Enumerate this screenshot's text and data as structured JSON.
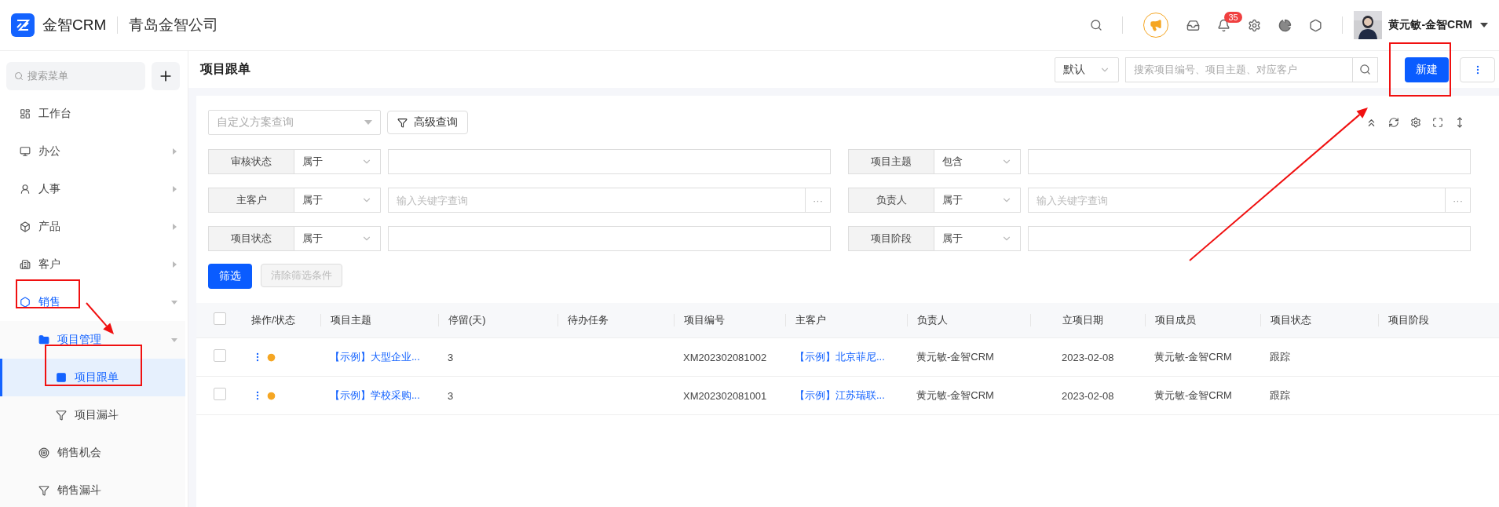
{
  "app": {
    "brand": "金智CRM",
    "company": "青岛金智公司"
  },
  "header": {
    "notification_count": "35",
    "user_name": "黄元敏-金智CRM"
  },
  "sidebar": {
    "search_placeholder": "搜索菜单",
    "items": [
      {
        "label": "工作台",
        "selected": false
      },
      {
        "label": "办公",
        "selected": false,
        "expanded": false
      },
      {
        "label": "人事",
        "selected": false,
        "expanded": false
      },
      {
        "label": "产品",
        "selected": false,
        "expanded": false
      },
      {
        "label": "客户",
        "selected": false,
        "expanded": false
      },
      {
        "label": "销售",
        "selected": false,
        "expanded": true,
        "children": [
          {
            "label": "项目管理",
            "selected": false,
            "expanded": true,
            "children": [
              {
                "label": "项目跟单",
                "selected": true
              },
              {
                "label": "项目漏斗",
                "selected": false
              }
            ]
          },
          {
            "label": "销售机会",
            "selected": false
          },
          {
            "label": "销售漏斗",
            "selected": false
          }
        ]
      }
    ]
  },
  "page": {
    "title": "项目跟单",
    "view_select": "默认",
    "search_placeholder": "搜索项目编号、项目主题、对应客户",
    "new_button": "新建"
  },
  "filter": {
    "scheme_placeholder": "自定义方案查询",
    "advanced_button": "高级查询",
    "conditions": [
      {
        "label": "审核状态",
        "operator": "属于"
      },
      {
        "label": "项目主题",
        "operator": "包含"
      },
      {
        "label": "主客户",
        "operator": "属于",
        "placeholder": "输入关键字查询",
        "picker": "···"
      },
      {
        "label": "负责人",
        "operator": "属于",
        "placeholder": "输入关键字查询",
        "picker": "···"
      },
      {
        "label": "项目状态",
        "operator": "属于"
      },
      {
        "label": "项目阶段",
        "operator": "属于"
      }
    ],
    "apply_button": "筛选",
    "clear_button": {
      "label": "清除筛选条件",
      "disabled": true
    }
  },
  "table": {
    "header_checked": false,
    "columns": [
      "操作/状态",
      "项目主题",
      "停留(天)",
      "待办任务",
      "项目编号",
      "主客户",
      "负责人",
      "立项日期",
      "项目成员",
      "项目状态",
      "项目阶段"
    ],
    "rows": [
      {
        "checked": false,
        "cells": [
          "",
          "【示例】大型企业...",
          "3",
          "",
          "XM202302081002",
          "【示例】北京菲尼...",
          "黄元敏-金智CRM",
          "2023-02-08",
          "黄元敏-金智CRM",
          "跟踪",
          ""
        ]
      },
      {
        "checked": false,
        "cells": [
          "",
          "【示例】学校采购...",
          "3",
          "",
          "XM202302081001",
          "【示例】江苏瑞联...",
          "黄元敏-金智CRM",
          "2023-02-08",
          "黄元敏-金智CRM",
          "跟踪",
          ""
        ]
      }
    ]
  },
  "annotations": [
    {
      "kind": "box"
    },
    {
      "kind": "arrow"
    },
    {
      "kind": "box"
    },
    {
      "kind": "box"
    },
    {
      "kind": "arrow"
    }
  ]
}
